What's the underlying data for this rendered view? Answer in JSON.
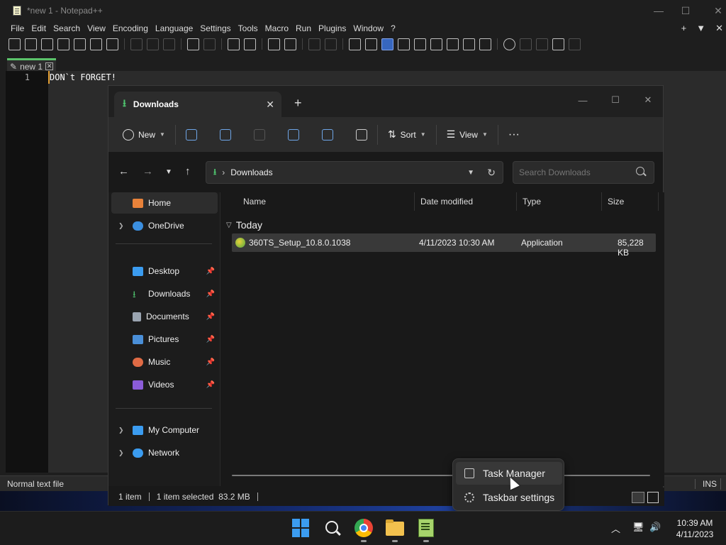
{
  "notepad": {
    "title": "*new 1 - Notepad++",
    "menu": [
      "File",
      "Edit",
      "Search",
      "View",
      "Encoding",
      "Language",
      "Settings",
      "Tools",
      "Macro",
      "Run",
      "Plugins",
      "Window",
      "?"
    ],
    "menu_right": [
      "+",
      "▼",
      "✕"
    ],
    "tab_label": "new 1",
    "line_number": "1",
    "line_text": "DON`t FORGET!",
    "status_left": "Normal text file",
    "status_ins": "INS"
  },
  "explorer": {
    "tab_title": "Downloads",
    "commands": {
      "new": "New",
      "sort": "Sort",
      "view": "View",
      "more": "···"
    },
    "address": "Downloads",
    "search_placeholder": "Search Downloads",
    "sidebar": [
      {
        "label": "Home",
        "icon": "home-icon",
        "color": "#e8823a"
      },
      {
        "label": "OneDrive",
        "icon": "cloud-icon",
        "color": "#3b8fe0"
      },
      {
        "label": "Desktop",
        "icon": "desktop-icon",
        "color": "#3b9cf0"
      },
      {
        "label": "Downloads",
        "icon": "download-icon",
        "color": "#4fc46e"
      },
      {
        "label": "Documents",
        "icon": "document-icon",
        "color": "#9aa4b0"
      },
      {
        "label": "Pictures",
        "icon": "picture-icon",
        "color": "#4a8fd8"
      },
      {
        "label": "Music",
        "icon": "music-icon",
        "color": "#e06b45"
      },
      {
        "label": "Videos",
        "icon": "video-icon",
        "color": "#8b5cd8"
      },
      {
        "label": "My Computer",
        "icon": "computer-icon",
        "color": "#3b9cf0"
      },
      {
        "label": "Network",
        "icon": "network-icon",
        "color": "#3b9cf0"
      }
    ],
    "columns": [
      "Name",
      "Date modified",
      "Type",
      "Size"
    ],
    "group": "Today",
    "files": [
      {
        "name": "360TS_Setup_10.8.0.1038",
        "date": "4/11/2023 10:30 AM",
        "type": "Application",
        "size": "85,228 KB"
      }
    ],
    "status": {
      "count": "1 item",
      "selected": "1 item selected  83.2 MB"
    }
  },
  "context_menu": [
    {
      "label": "Task Manager",
      "icon": "task-manager-icon"
    },
    {
      "label": "Taskbar settings",
      "icon": "gear-icon"
    }
  ],
  "taskbar": {
    "time": "10:39 AM",
    "date": "4/11/2023"
  }
}
